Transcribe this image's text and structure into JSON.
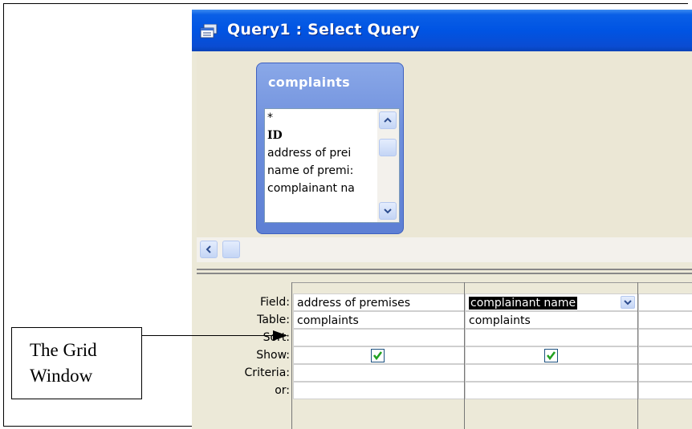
{
  "window": {
    "title": "Query1 : Select Query"
  },
  "table_box": {
    "title": "complaints",
    "fields": [
      "*",
      "ID",
      "address of premises",
      "name of premises",
      "complainant name"
    ],
    "fields_visible": [
      "*",
      "ID",
      "address of prei",
      "name of premi:",
      "complainant na"
    ]
  },
  "grid": {
    "row_labels": [
      "Field:",
      "Table:",
      "Sort:",
      "Show:",
      "Criteria:",
      "or:"
    ],
    "columns": [
      {
        "field": "address of premises",
        "table": "complaints",
        "sort": "",
        "show": true,
        "criteria": "",
        "or": ""
      },
      {
        "field": "complainant name",
        "table": "complaints",
        "sort": "",
        "show": true,
        "criteria": "",
        "or": ""
      },
      {
        "field": "",
        "table": "",
        "sort": "",
        "show": false,
        "criteria": "",
        "or": ""
      }
    ]
  },
  "annotation": {
    "line1": "The Grid",
    "line2": "Window"
  },
  "colors": {
    "titlebar": "#0054e3",
    "table_box": "#6e8fdc",
    "checkmark": "#21a121"
  }
}
